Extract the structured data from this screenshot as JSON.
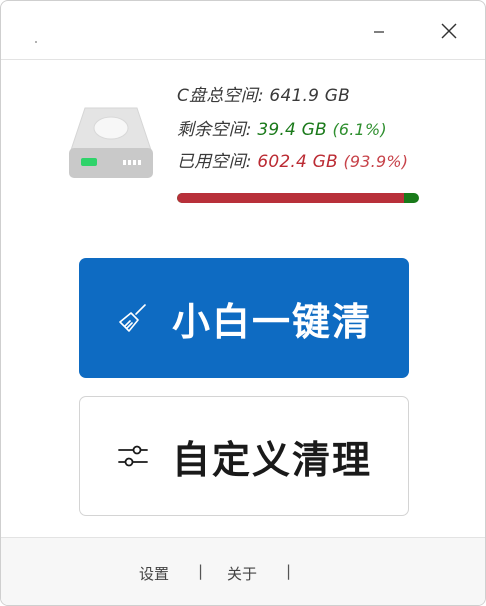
{
  "titlebar": {
    "minimize_icon": "minimize-icon",
    "close_icon": "close-icon"
  },
  "disk": {
    "icon": "hard-drive-icon",
    "total_label": "C盘总空间:",
    "total_value": "641.9 GB",
    "free_label": "剩余空间:",
    "free_value": "39.4 GB",
    "free_percent": "(6.1%)",
    "used_label": "已用空间:",
    "used_value": "602.4 GB",
    "used_percent": "(93.9%)",
    "used_fraction": 0.939,
    "used_color": "#b8303a",
    "free_color": "#197a1a"
  },
  "actions": {
    "oneclick_label": "小白一键清",
    "oneclick_icon": "broom-icon",
    "oneclick_color": "#0e6bc2",
    "custom_label": "自定义清理",
    "custom_icon": "sliders-icon"
  },
  "footer": {
    "settings_label": "设置",
    "separator": "|",
    "about_label": "关于"
  }
}
